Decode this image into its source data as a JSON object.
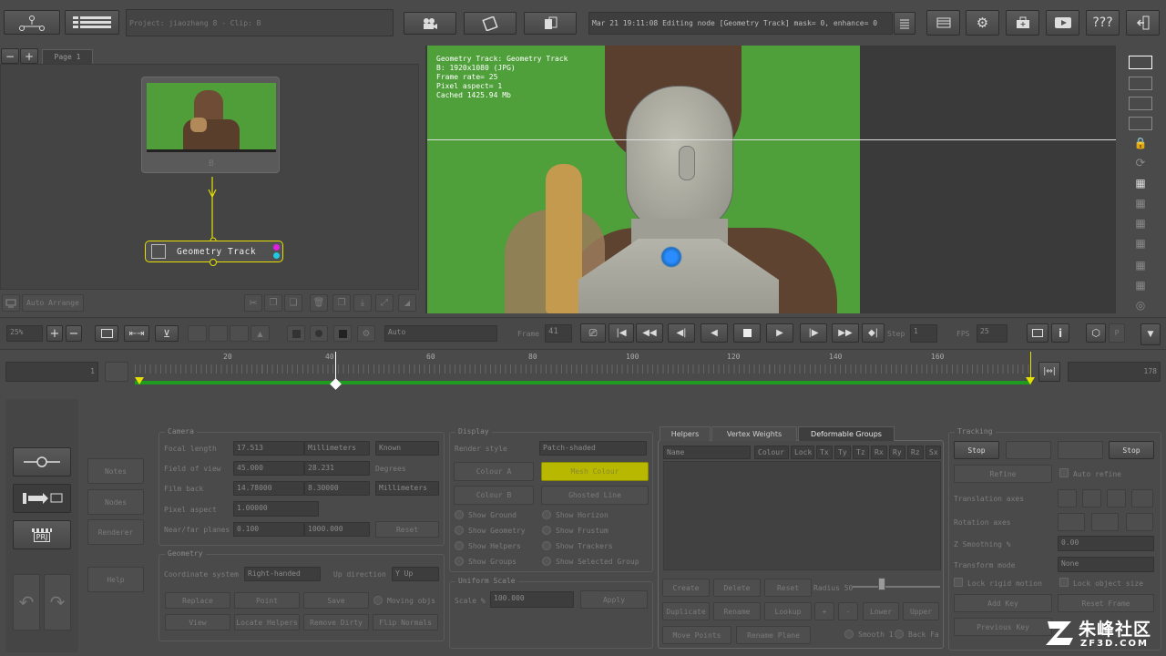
{
  "top": {
    "project_label": "Project: jiaozhang 8 - Clip: B",
    "status_message": "Mar 21 19:11:08 Editing node [Geometry Track] mask= 0, enhance= 0",
    "help_label": "???"
  },
  "node_panel": {
    "page_tab": "Page 1",
    "source_node_label": "B",
    "track_node_label": "Geometry Track",
    "auto_arrange": "Auto Arrange"
  },
  "viewer": {
    "info_lines": [
      "Geometry Track: Geometry Track",
      "B: 1920x1080 (JPG)",
      "Frame rate= 25",
      "Pixel aspect= 1",
      "Cached 1425.94 Mb"
    ]
  },
  "transport": {
    "zoom_value": "25%",
    "display_mode": "Auto",
    "frame_label": "Frame",
    "frame_value": "41",
    "step_label": "Step",
    "step_value": "1",
    "fps_label": "FPS",
    "fps_value": "25",
    "p_label": "P"
  },
  "timeline": {
    "start_frame": "1",
    "end_frame": "178",
    "ticks": [
      "20",
      "40",
      "60",
      "80",
      "100",
      "120",
      "140",
      "160"
    ]
  },
  "left_tools": {
    "notes": "Notes",
    "ref_nodes": "Nodes",
    "render": "Renderer",
    "help": "Help",
    "prj": "PRJ"
  },
  "camera": {
    "title": "Camera",
    "focal_length_label": "Focal length",
    "focal_length_value": "17.513",
    "focal_length_unit": "Millimeters",
    "focal_length_mode": "Known",
    "fov_label": "Field of view",
    "fov_value_1": "45.000",
    "fov_value_2": "28.231",
    "fov_unit": "Degrees",
    "film_back_label": "Film back",
    "film_back_value_1": "14.78000",
    "film_back_value_2": "8.30000",
    "film_back_unit": "Millimeters",
    "pixel_aspect_label": "Pixel aspect",
    "pixel_aspect_value": "1.00000",
    "near_far_label": "Near/far planes",
    "near_value": "0.100",
    "far_value": "1000.000",
    "reset": "Reset"
  },
  "geometry": {
    "title": "Geometry",
    "coord_label": "Coordinate system",
    "coord_value": "Right-handed",
    "up_label": "Up direction",
    "up_value": "Y Up",
    "buttons": [
      "Replace",
      "Point",
      "Save",
      "View",
      "Locate Helpers",
      "Remove Dirty",
      "Flip Normals"
    ],
    "moving_objs": "Moving objs"
  },
  "display": {
    "title": "Display",
    "render_style_label": "Render style",
    "render_style_value": "Patch-shaded",
    "mesh_colour": "Mesh Colour",
    "colour_a": "Colour A",
    "colour_b": "Colour B",
    "ghost_colour": "Ghosted Line",
    "checks": [
      "Show Ground",
      "Show Horizon",
      "Show Geometry",
      "Show Frustum",
      "Show Helpers",
      "Show Trackers",
      "Show Groups",
      "Show Selected Group"
    ]
  },
  "uniform_scale": {
    "title": "Uniform Scale",
    "scale_label": "Scale %",
    "scale_value": "100.000",
    "apply": "Apply"
  },
  "groups_panel": {
    "tabs": [
      "Helpers",
      "Vertex Weights",
      "Deformable Groups"
    ],
    "name_col": "Name",
    "cols": [
      "Colour",
      "Lock",
      "Tx",
      "Ty",
      "Tz",
      "Rx",
      "Ry",
      "Rz",
      "Sx"
    ],
    "buttons_row1": [
      "Create",
      "Delete",
      "Reset"
    ],
    "radius_label": "Radius 50",
    "buttons_row2": [
      "Duplicate",
      "Rename",
      "Lookup",
      "+",
      "-",
      "Lower",
      "Upper"
    ],
    "buttons_row3": [
      "Move Points",
      "Rename Plane"
    ],
    "smooth": "Smooth 1",
    "back_face": "Back Fa"
  },
  "tracking": {
    "title": "Tracking",
    "stop_left": "Stop",
    "stop_right": "Stop",
    "refine": "Refine",
    "auto_refine": "Auto refine",
    "translation_axes": "Translation axes",
    "rotation_axes": "Rotation axes",
    "z_smoothing": "Z Smoothing %",
    "z_smoothing_value": "0.00",
    "transform_mode": "Transform mode",
    "transform_mode_value": "None",
    "lock_rigid_motion": "Lock rigid motion",
    "lock_object_size": "Lock object size",
    "add_key": "Add Key",
    "reset_frame": "Reset Frame",
    "previous_key": "Previous Key"
  },
  "watermark": {
    "brand": "朱峰社区",
    "site": "ZF3D.COM"
  },
  "colors": {
    "accent_yellow": "#e6e000",
    "timeline_green": "#1f9c1f",
    "greenscreen": "#4fa03a"
  }
}
